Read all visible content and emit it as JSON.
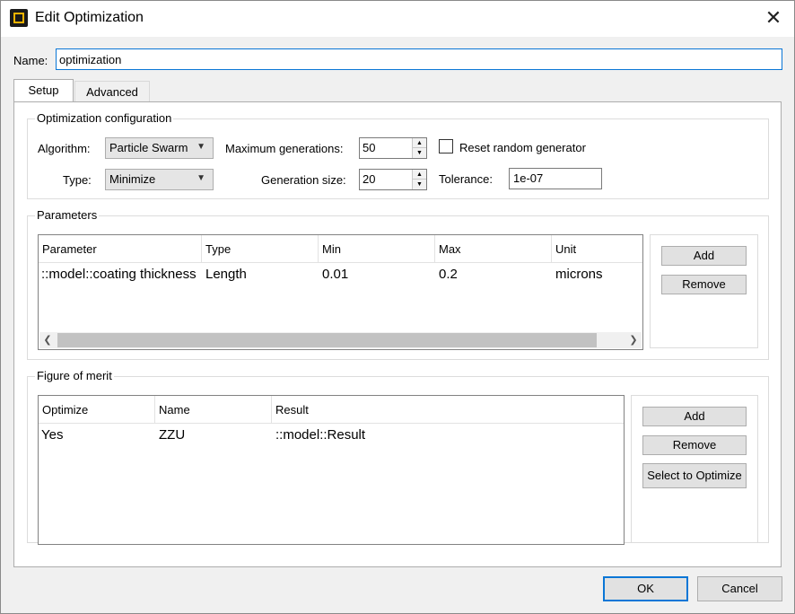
{
  "window": {
    "title": "Edit Optimization",
    "close_symbol": "✕"
  },
  "name": {
    "label": "Name:",
    "value": "optimization"
  },
  "tabs": [
    {
      "label": "Setup",
      "active": true
    },
    {
      "label": "Advanced",
      "active": false
    }
  ],
  "config": {
    "title": "Optimization configuration",
    "algorithm_label": "Algorithm:",
    "algorithm_value": "Particle Swarm",
    "type_label": "Type:",
    "type_value": "Minimize",
    "max_generations_label": "Maximum generations:",
    "max_generations_value": "50",
    "generation_size_label": "Generation size:",
    "generation_size_value": "20",
    "reset_label": "Reset random generator",
    "reset_checked": false,
    "tolerance_label": "Tolerance:",
    "tolerance_value": "1e-07"
  },
  "parameters": {
    "title": "Parameters",
    "columns": [
      "Parameter",
      "Type",
      "Min",
      "Max",
      "Unit"
    ],
    "rows": [
      [
        "::model::coating thickness",
        "Length",
        "0.01",
        "0.2",
        "microns"
      ]
    ],
    "add_label": "Add",
    "remove_label": "Remove"
  },
  "figure_of_merit": {
    "title": "Figure of merit",
    "columns": [
      "Optimize",
      "Name",
      "Result"
    ],
    "rows": [
      [
        "Yes",
        "ZZU",
        "::model::Result"
      ]
    ],
    "add_label": "Add",
    "remove_label": "Remove",
    "select_label": "Select to Optimize"
  },
  "footer": {
    "ok_label": "OK",
    "cancel_label": "Cancel"
  },
  "colors": {
    "accent": "#0a76d6",
    "icon_bg": "#1a1a1a",
    "icon_fg": "#f2b300"
  },
  "icons": {
    "app": "app-icon",
    "close": "close-icon",
    "dropdown": "chevron-down-icon",
    "spin": "spin-arrows-icon",
    "scroll_left": "chevron-left-icon",
    "scroll_right": "chevron-right-icon"
  }
}
